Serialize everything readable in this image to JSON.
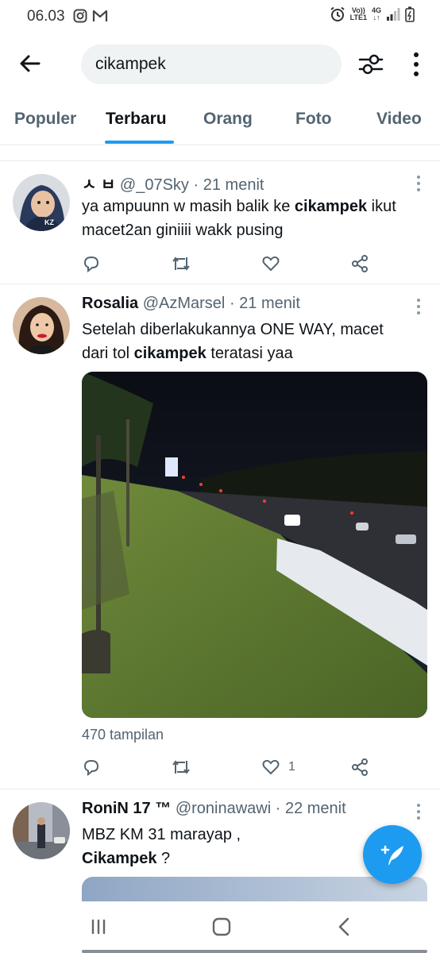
{
  "status_bar": {
    "time": "06.03",
    "left_icons": [
      "instagram-icon",
      "gmail-icon"
    ],
    "right_icons": [
      "alarm-icon",
      "volte-icon",
      "4g-icon",
      "signal-icon",
      "battery-icon"
    ],
    "volte_label": "Vo)) LTE1",
    "net_label": "4G"
  },
  "header": {
    "back_icon": "arrow-left-icon",
    "search_value": "cikampek",
    "filter_icon": "sliders-icon",
    "more_icon": "more-vertical-icon"
  },
  "tabs": [
    {
      "label": "Populer",
      "active": false
    },
    {
      "label": "Terbaru",
      "active": true
    },
    {
      "label": "Orang",
      "active": false
    },
    {
      "label": "Foto",
      "active": false
    },
    {
      "label": "Video",
      "active": false
    }
  ],
  "tweets": [
    {
      "name": "ㅅ ㅂ",
      "handle": "@_07Sky",
      "time": "21 menit",
      "text_parts": [
        "ya ampuunn w masih balik ke ",
        "cikampek",
        " ikut macet2an giniiii wakk pusing"
      ],
      "like_count": ""
    },
    {
      "name": "Rosalia",
      "handle": "@AzMarsel",
      "time": "21 menit",
      "text_parts": [
        "Setelah diberlakukannya ONE WAY, macet dari tol ",
        "cikampek",
        " teratasi yaa"
      ],
      "views": "470 tampilan",
      "like_count": "1"
    },
    {
      "name": "RoniN 17 ™",
      "handle": "@roninawawi",
      "time": "22 menit",
      "text_parts": [
        "MBZ KM 31 marayap ,",
        "Cikampek",
        " ?"
      ]
    }
  ],
  "action_icons": [
    "reply-icon",
    "retweet-icon",
    "like-icon",
    "share-icon"
  ],
  "fab_icon": "compose-feather-icon",
  "colors": {
    "accent": "#1d9bf0",
    "text": "#0f1419",
    "secondary": "#536471"
  },
  "nav": [
    "recent-apps-icon",
    "home-icon",
    "back-icon"
  ]
}
